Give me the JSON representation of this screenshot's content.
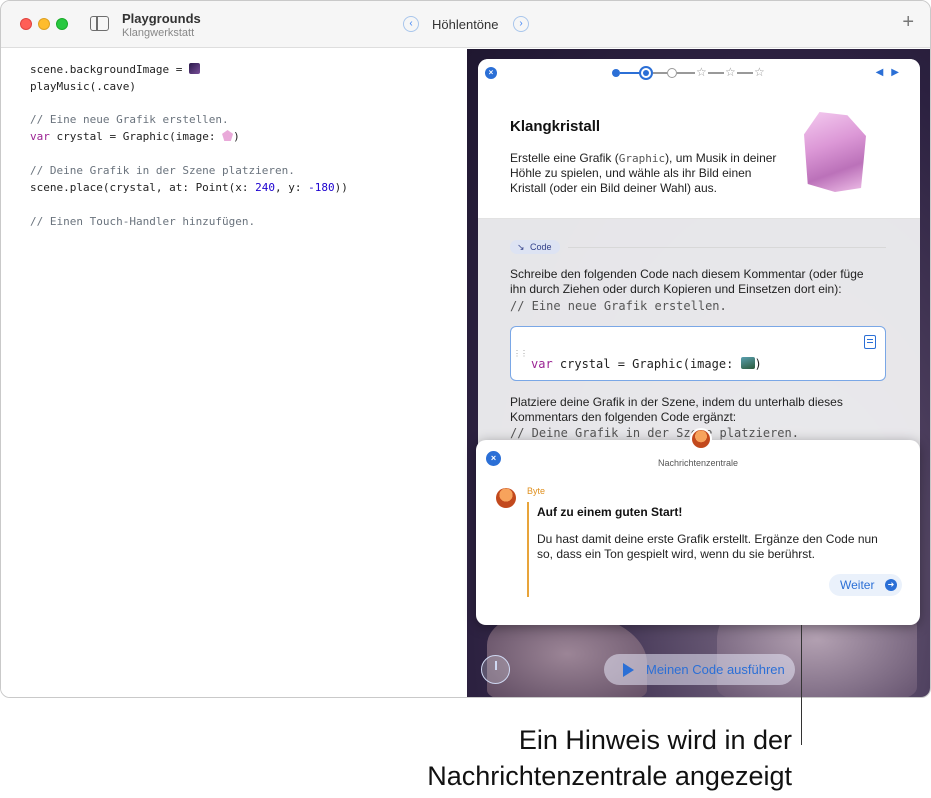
{
  "window": {
    "title": "Playgrounds",
    "subtitle": "Klangwerkstatt",
    "page_title": "Höhlentöne",
    "nav_back": "‹",
    "nav_forward": "›",
    "add": "+"
  },
  "editor": {
    "line1": "scene.backgroundImage = ",
    "line2": "playMusic(.cave)",
    "line3": "// Eine neue Grafik erstellen.",
    "line4_kw": "var",
    "line4_rest": " crystal = Graphic(image: ",
    "line4_end": ")",
    "line5": "// Deine Grafik in der Szene platzieren.",
    "line6_a": "scene.place(crystal, at: Point(x: ",
    "line6_x": "240",
    "line6_b": ", y: ",
    "line6_y": "-180",
    "line6_c": "))",
    "line7": "// Einen Touch-Handler hinzufügen."
  },
  "guide": {
    "close": "×",
    "arrows": "◀▶",
    "star": "☆",
    "title": "Klangkristall",
    "desc_a": "Erstelle eine Grafik (",
    "desc_code": "Graphic",
    "desc_b": "), um Musik in deiner Höhle zu spielen, und wähle als ihr Bild einen Kristall (oder ein Bild deiner Wahl) aus.",
    "code_tag": "Code",
    "para1": "Schreibe den folgenden Code nach diesem Kommentar (oder füge ihn durch Ziehen oder durch Kopieren und Einsetzen dort ein):",
    "mono1": "// Eine neue Grafik erstellen.",
    "grip": "⋮⋮",
    "box_kw": "var",
    "box_rest": " crystal = Graphic(image: ",
    "box_end": ")",
    "para2": "Platziere deine Grafik in der Szene, indem du unterhalb dieses Kommentars den folgenden Code ergänzt:",
    "mono2": "// Deine Grafik in der Szene platzieren."
  },
  "notification": {
    "close": "×",
    "title": "Nachrichtenzentrale",
    "from": "Byte",
    "headline": "Auf zu einem guten Start!",
    "body": "Du hast damit deine erste Grafik erstellt. Ergänze den Code nun so, dass ein Ton gespielt wird, wenn du sie berührst.",
    "button": "Weiter",
    "button_icon": "➜"
  },
  "run_button": "Meinen Code ausführen",
  "callout": {
    "line1": "Ein Hinweis wird in der",
    "line2": "Nachrichtenzentrale angezeigt"
  },
  "progress": {
    "current_step": 2,
    "total_steps": 7
  }
}
